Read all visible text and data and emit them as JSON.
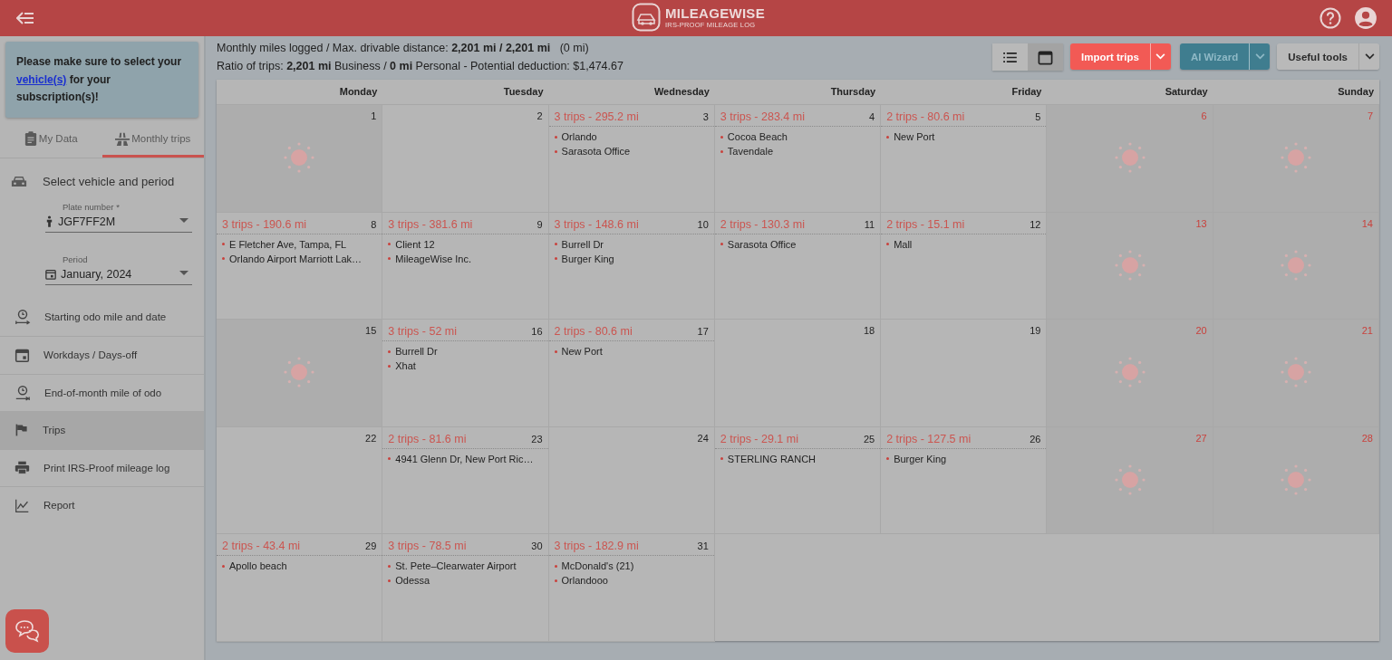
{
  "header": {
    "logo_title": "MILEAGEWISE",
    "logo_subtitle": "IRS-PROOF MILEAGE LOG"
  },
  "sidebar": {
    "notice": {
      "before": "Please make sure to select your",
      "link": "vehicle(s)",
      "after": "for your subscription(s)!"
    },
    "tabs": [
      {
        "label": "My Data",
        "kind": "clipboard",
        "selected": false
      },
      {
        "label": "Monthly trips",
        "kind": "road",
        "selected": true
      }
    ],
    "section_title": "Select vehicle and period",
    "plate_field": {
      "label": "Plate number *",
      "value": "JGF7FF2M"
    },
    "period_field": {
      "label": "Period",
      "value": "January, 2024"
    },
    "menu": [
      {
        "label": "Starting odo mile and date",
        "kind": "odo-start",
        "selected": false
      },
      {
        "label": "Workdays / Days-off",
        "kind": "calendar",
        "selected": false
      },
      {
        "label": "End-of-month mile of odo",
        "kind": "odo-end",
        "selected": false
      },
      {
        "label": "Trips",
        "kind": "flag",
        "selected": true
      },
      {
        "label": "Print IRS-Proof mileage log",
        "kind": "print",
        "selected": false
      },
      {
        "label": "Report",
        "kind": "chart",
        "selected": false
      }
    ]
  },
  "stats": {
    "line_1": "Monthly miles logged / Max. drivable distance: **2,201 mi / 2,201 mi**   (0 mi)",
    "line_2": "Ratio of trips: **2,201 mi** Business / **0 mi** Personal - Potential deduction: $1,474.67"
  },
  "toolbar": {
    "view_toggle": [
      {
        "kind": "list",
        "selected": false
      },
      {
        "kind": "calendar",
        "selected": true
      }
    ],
    "buttons": [
      {
        "label": "Import trips",
        "kind": "primary"
      },
      {
        "label": "AI Wizard",
        "kind": "secondary"
      },
      {
        "label": "Useful tools",
        "kind": "neutral"
      }
    ]
  },
  "calendar": {
    "weekdays": [
      "Monday",
      "Tuesday",
      "Wednesday",
      "Thursday",
      "Friday",
      "Saturday",
      "Sunday"
    ],
    "days": [
      {
        "day": "1",
        "day_off": true,
        "weekend": false
      },
      {
        "day": "2",
        "day_off": false,
        "weekend": false
      },
      {
        "day": "3",
        "day_off": false,
        "weekend": false,
        "summary": "3 trips - 295.2 mi",
        "stops": [
          "Orlando",
          "Sarasota Office"
        ]
      },
      {
        "day": "4",
        "day_off": false,
        "weekend": false,
        "summary": "3 trips - 283.4 mi",
        "stops": [
          "Cocoa Beach",
          "Tavendale"
        ]
      },
      {
        "day": "5",
        "day_off": false,
        "weekend": false,
        "summary": "2 trips - 80.6 mi",
        "stops": [
          "New Port"
        ]
      },
      {
        "day": "6",
        "day_off": true,
        "weekend": true
      },
      {
        "day": "7",
        "day_off": true,
        "weekend": true
      },
      {
        "day": "8",
        "day_off": false,
        "weekend": false,
        "summary": "3 trips - 190.6 mi",
        "stops": [
          "E Fletcher Ave, Tampa, FL",
          "Orlando Airport Marriott Lak…"
        ]
      },
      {
        "day": "9",
        "day_off": false,
        "weekend": false,
        "summary": "3 trips - 381.6 mi",
        "stops": [
          "Client 12",
          "MileageWise Inc."
        ]
      },
      {
        "day": "10",
        "day_off": false,
        "weekend": false,
        "summary": "3 trips - 148.6 mi",
        "stops": [
          "Burrell Dr",
          "Burger King"
        ]
      },
      {
        "day": "11",
        "day_off": false,
        "weekend": false,
        "summary": "2 trips - 130.3 mi",
        "stops": [
          "Sarasota Office"
        ]
      },
      {
        "day": "12",
        "day_off": false,
        "weekend": false,
        "summary": "2 trips - 15.1 mi",
        "stops": [
          "Mall"
        ]
      },
      {
        "day": "13",
        "day_off": true,
        "weekend": true
      },
      {
        "day": "14",
        "day_off": true,
        "weekend": true
      },
      {
        "day": "15",
        "day_off": true,
        "weekend": false
      },
      {
        "day": "16",
        "day_off": false,
        "weekend": false,
        "summary": "3 trips - 52 mi",
        "stops": [
          "Burrell Dr",
          "Xhat"
        ]
      },
      {
        "day": "17",
        "day_off": false,
        "weekend": false,
        "summary": "2 trips - 80.6 mi",
        "stops": [
          "New Port"
        ]
      },
      {
        "day": "18",
        "day_off": false,
        "weekend": false
      },
      {
        "day": "19",
        "day_off": false,
        "weekend": false
      },
      {
        "day": "20",
        "day_off": true,
        "weekend": true
      },
      {
        "day": "21",
        "day_off": true,
        "weekend": true
      },
      {
        "day": "22",
        "day_off": false,
        "weekend": false
      },
      {
        "day": "23",
        "day_off": false,
        "weekend": false,
        "summary": "2 trips - 81.6 mi",
        "stops": [
          "4941 Glenn Dr, New Port Ric…"
        ]
      },
      {
        "day": "24",
        "day_off": false,
        "weekend": false
      },
      {
        "day": "25",
        "day_off": false,
        "weekend": false,
        "summary": "2 trips - 29.1 mi",
        "stops": [
          "STERLING RANCH"
        ]
      },
      {
        "day": "26",
        "day_off": false,
        "weekend": false,
        "summary": "2 trips - 127.5 mi",
        "stops": [
          "Burger King"
        ]
      },
      {
        "day": "27",
        "day_off": true,
        "weekend": true
      },
      {
        "day": "28",
        "day_off": true,
        "weekend": true
      },
      {
        "day": "29",
        "day_off": false,
        "weekend": false,
        "summary": "2 trips - 43.4 mi",
        "stops": [
          "Apollo beach"
        ]
      },
      {
        "day": "30",
        "day_off": false,
        "weekend": false,
        "summary": "3 trips - 78.5 mi",
        "stops": [
          "St. Pete–Clearwater Airport",
          "Odessa"
        ]
      },
      {
        "day": "31",
        "day_off": false,
        "weekend": false,
        "summary": "3 trips - 182.9 mi",
        "stops": [
          "McDonald's (21)",
          "Orlandooo"
        ]
      }
    ]
  }
}
